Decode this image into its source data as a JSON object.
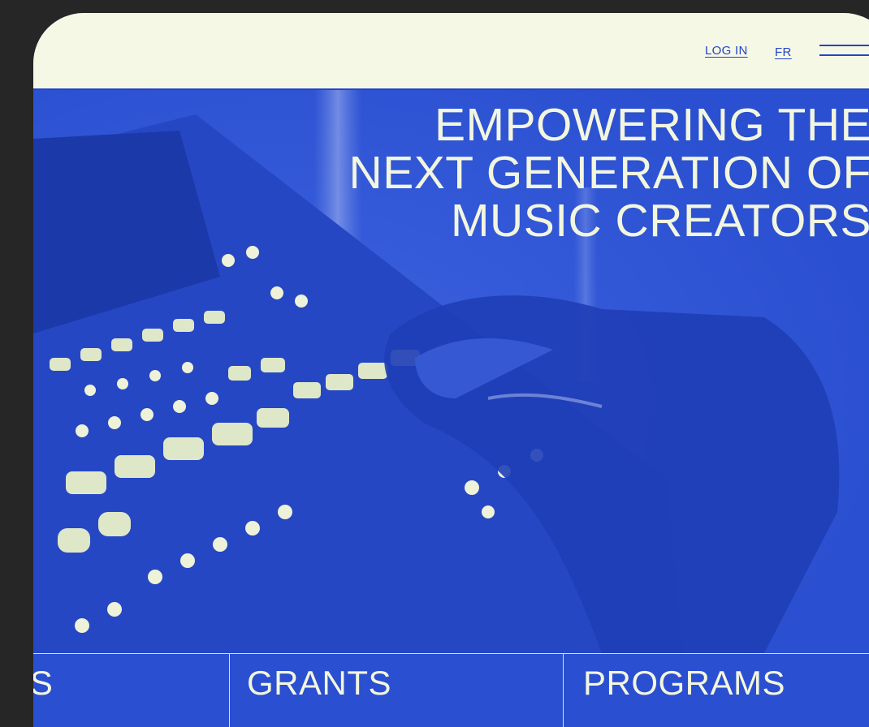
{
  "header": {
    "login_label": "LOG IN",
    "language_label": "FR",
    "menu_icon": "hamburger-menu-icon"
  },
  "hero": {
    "headline_lines": [
      "EMPOWERING THE",
      "NEXT GENERATION OF",
      "MUSIC CREATORS"
    ],
    "image": "mixing-console-with-hand",
    "tint_color": "#2a4fd0",
    "text_color": "#f3f6df"
  },
  "bottom_nav": {
    "tabs": [
      {
        "label": "DS"
      },
      {
        "label": "GRANTS"
      },
      {
        "label": "PROGRAMS"
      }
    ]
  },
  "colors": {
    "background": "#262626",
    "topbar": "#f6f8e6",
    "accent_blue": "#2244c8"
  }
}
